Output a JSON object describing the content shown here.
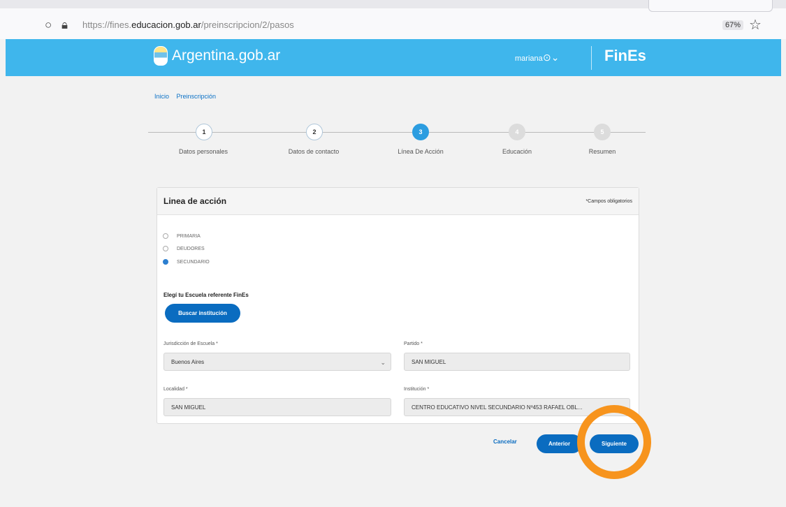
{
  "browser": {
    "url_prefix": "https://fines.",
    "url_domain": "educacion.gob.ar",
    "url_path": "/preinscripcion/2/pasos",
    "zoom": "67%",
    "icons": [
      "shield-icon",
      "lock-icon",
      "star-icon"
    ]
  },
  "header": {
    "logo_text": "Argentina.gob.ar",
    "user_name": "mariana",
    "brand": "FinEs",
    "color": "#3fb6ec"
  },
  "breadcrumb": [
    "Inicio",
    "Preinscripción"
  ],
  "steps": [
    {
      "num": "1",
      "label": "Datos personales",
      "state": "done"
    },
    {
      "num": "2",
      "label": "Datos de contacto",
      "state": "done"
    },
    {
      "num": "3",
      "label": "Línea De Acción",
      "state": "active"
    },
    {
      "num": "4",
      "label": "Educación",
      "state": "todo"
    },
    {
      "num": "5",
      "label": "Resumen",
      "state": "todo"
    }
  ],
  "card": {
    "title": "Linea de acción",
    "required_note": "*Campos obligatorios",
    "options": [
      {
        "label": "PRIMARIA",
        "checked": false
      },
      {
        "label": "DEUDORES",
        "checked": false
      },
      {
        "label": "SECUNDARIO",
        "checked": true
      }
    ],
    "school_label": "Elegí tu Escuela referente FinEs",
    "search_button": "Buscar institución",
    "fields": {
      "jurisdiccion": {
        "label": "Jurisdicción de Escuela *",
        "value": "Buenos Aires"
      },
      "partido": {
        "label": "Partido *",
        "value": "SAN MIGUEL"
      },
      "localidad": {
        "label": "Localidad *",
        "value": "SAN MIGUEL"
      },
      "institucion": {
        "label": "Institución *",
        "value": "CENTRO EDUCATIVO NIVEL SECUNDARIO Nº453 RAFAEL OBL..."
      }
    }
  },
  "actions": {
    "cancel": "Cancelar",
    "previous": "Anterior",
    "next": "Siguiente"
  },
  "colors": {
    "primary": "#0a6cc0",
    "highlight": "#f7941d"
  }
}
